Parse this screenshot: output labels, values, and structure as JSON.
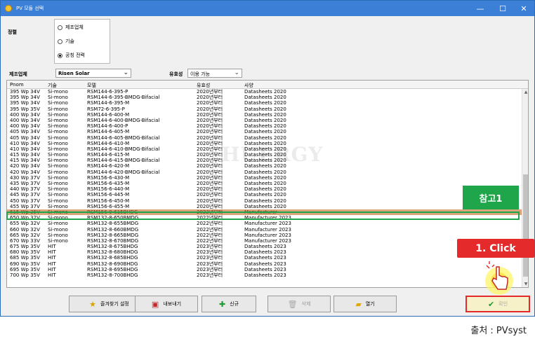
{
  "window": {
    "title": "PV 모듈 선택",
    "min": "—",
    "max": "☐",
    "close": "✕"
  },
  "sort": {
    "label": "정렬",
    "options": [
      {
        "label": "제조업체",
        "selected": false
      },
      {
        "label": "기술",
        "selected": false
      },
      {
        "label": "공칭 전력",
        "selected": true
      }
    ]
  },
  "filters": {
    "maker_label": "제조업체",
    "maker_value": "Risen Solar",
    "valid_label": "유효성",
    "valid_value": "이용 가능"
  },
  "table": {
    "columns": [
      "Pnom",
      "기술",
      "모델",
      "유효성",
      "사양"
    ],
    "rows": [
      [
        "395 Wp 34V",
        "Si-mono",
        "RSM144-6-395-P",
        "2020년부터",
        "Datasheets 2020"
      ],
      [
        "395 Wp 34V",
        "Si-mono",
        "RSM144-6-395-BMDG-Bifacial",
        "2020년부터",
        "Datasheets 2020"
      ],
      [
        "395 Wp 34V",
        "Si-mono",
        "RSM144-6-395-M",
        "2020년부터",
        "Datasheets 2020"
      ],
      [
        "395 Wp 35V",
        "Si-mono",
        "RSM72-6-395-P",
        "2020년부터",
        "Datasheets 2020"
      ],
      [
        "400 Wp 34V",
        "Si-mono",
        "RSM144-6-400-M",
        "2020년부터",
        "Datasheets 2020"
      ],
      [
        "400 Wp 34V",
        "Si-mono",
        "RSM144-6-400-BMDG-Bifacial",
        "2020년부터",
        "Datasheets 2020"
      ],
      [
        "400 Wp 34V",
        "Si-mono",
        "RSM144-6-400-P",
        "2020년부터",
        "Datasheets 2020"
      ],
      [
        "405 Wp 34V",
        "Si-mono",
        "RSM144-6-405-M",
        "2020년부터",
        "Datasheets 2020"
      ],
      [
        "405 Wp 34V",
        "Si-mono",
        "RSM144-6-405-BMDG-Bifacial",
        "2020년부터",
        "Datasheets 2020"
      ],
      [
        "410 Wp 34V",
        "Si-mono",
        "RSM144-6-410-M",
        "2020년부터",
        "Datasheets 2020"
      ],
      [
        "410 Wp 34V",
        "Si-mono",
        "RSM144-6-410-BMDG-Bifacial",
        "2020년부터",
        "Datasheets 2020"
      ],
      [
        "415 Wp 34V",
        "Si-mono",
        "RSM144-6-415-M",
        "2020년부터",
        "Datasheets 2020"
      ],
      [
        "415 Wp 34V",
        "Si-mono",
        "RSM144-6-415-BMDG-Bifacial",
        "2020년부터",
        "Datasheets 2020"
      ],
      [
        "420 Wp 34V",
        "Si-mono",
        "RSM144-6-420-M",
        "2020년부터",
        "Datasheets 2020"
      ],
      [
        "420 Wp 34V",
        "Si-mono",
        "RSM144-6-420-BMDG-Bifacial",
        "2020년부터",
        "Datasheets 2020"
      ],
      [
        "430 Wp 37V",
        "Si-mono",
        "RSM156-6-430-M",
        "2020년부터",
        "Datasheets 2020"
      ],
      [
        "435 Wp 37V",
        "Si-mono",
        "RSM156-6-435-M",
        "2020년부터",
        "Datasheets 2020"
      ],
      [
        "440 Wp 37V",
        "Si-mono",
        "RSM156-6-440-M",
        "2020년부터",
        "Datasheets 2020"
      ],
      [
        "445 Wp 37V",
        "Si-mono",
        "RSM156-6-445-M",
        "2020년부터",
        "Datasheets 2020"
      ],
      [
        "450 Wp 37V",
        "Si-mono",
        "RSM156-6-450-M",
        "2020년부터",
        "Datasheets 2020"
      ],
      [
        "455 Wp 37V",
        "Si-mono",
        "RSM156-6-455-M",
        "2020년부터",
        "Datasheets 2020"
      ],
      [
        "615 Wp 35V",
        "Si-mono",
        "RSM156-9-615BHDG",
        "2022년부터",
        "Manufacturer"
      ],
      [
        "650 Wp 32V",
        "Si-mono",
        "RSM132-8-650BMDG",
        "2022년부터",
        "Manufacturer 2023"
      ],
      [
        "655 Wp 32V",
        "Si-mono",
        "RSM132-8-655BMDG",
        "2022년부터",
        "Manufacturer 2023"
      ],
      [
        "660 Wp 32V",
        "Si-mono",
        "RSM132-8-660BMDG",
        "2022년부터",
        "Manufacturer 2023"
      ],
      [
        "665 Wp 32V",
        "Si-mono",
        "RSM132-8-665BMDG",
        "2022년부터",
        "Manufacturer 2023"
      ],
      [
        "670 Wp 33V",
        "Si-mono",
        "RSM132-8-670BMDG",
        "2022년부터",
        "Manufacturer 2023"
      ],
      [
        "675 Wp 35V",
        "HIT",
        "RSM132-8-675BHDG",
        "2023년부터",
        "Datasheets 2023"
      ],
      [
        "680 Wp 35V",
        "HIT",
        "RSM132-8-680BHDG",
        "2023년부터",
        "Datasheets 2023"
      ],
      [
        "685 Wp 35V",
        "HIT",
        "RSM132-8-685BHDG",
        "2023년부터",
        "Datasheets 2023"
      ],
      [
        "690 Wp 35V",
        "HIT",
        "RSM132-8-690BHDG",
        "2023년부터",
        "Datasheets 2023"
      ],
      [
        "695 Wp 35V",
        "HIT",
        "RSM132-8-695BHDG",
        "2023년부터",
        "Datasheets 2023"
      ],
      [
        "700 Wp 35V",
        "HIT",
        "RSM132-8-700BHDG",
        "2023년부터",
        "Datasheets 2023"
      ]
    ],
    "selected_index": 21
  },
  "annotations": {
    "ref": "참고1",
    "click": "1. Click"
  },
  "watermark": "HUERGY",
  "buttons": {
    "favorites": "즐겨찾기 설정",
    "export": "내보내기",
    "new": "신규",
    "delete": "삭제",
    "open": "열기",
    "ok": "확인"
  },
  "source": "출처 : PVsyst",
  "colors": {
    "titlebar": "#3c7fd6",
    "selection": "#d9a57a",
    "ref_box": "#1fa54a",
    "click_badge": "#e42a2a"
  }
}
